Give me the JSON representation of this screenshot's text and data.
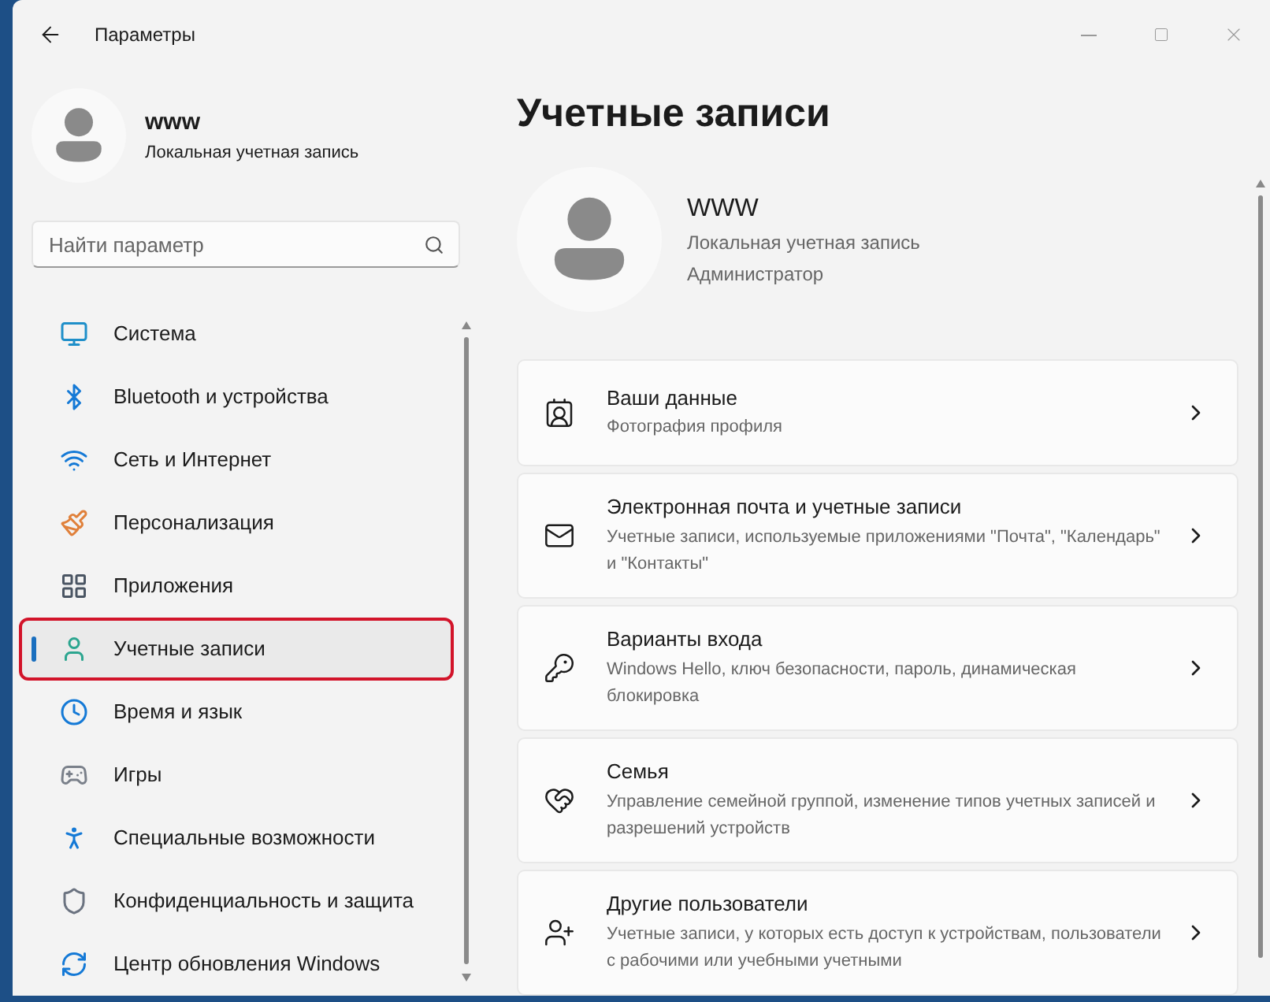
{
  "window": {
    "title": "Параметры"
  },
  "user": {
    "name": "www",
    "account": "Локальная учетная запись"
  },
  "search": {
    "placeholder": "Найти параметр"
  },
  "sidebar": {
    "items": [
      {
        "label": "Система",
        "kind": "system",
        "selected": false,
        "highlighted": false
      },
      {
        "label": "Bluetooth и устройства",
        "kind": "bluetooth",
        "selected": false,
        "highlighted": false
      },
      {
        "label": "Сеть и Интернет",
        "kind": "network",
        "selected": false,
        "highlighted": false
      },
      {
        "label": "Персонализация",
        "kind": "brush",
        "selected": false,
        "highlighted": false
      },
      {
        "label": "Приложения",
        "kind": "apps",
        "selected": false,
        "highlighted": false
      },
      {
        "label": "Учетные записи",
        "kind": "accounts",
        "selected": true,
        "highlighted": true
      },
      {
        "label": "Время и язык",
        "kind": "time",
        "selected": false,
        "highlighted": false
      },
      {
        "label": "Игры",
        "kind": "games",
        "selected": false,
        "highlighted": false
      },
      {
        "label": "Специальные возможности",
        "kind": "accessibility",
        "selected": false,
        "highlighted": false
      },
      {
        "label": "Конфиденциальность и защита",
        "kind": "privacy",
        "selected": false,
        "highlighted": false
      },
      {
        "label": "Центр обновления Windows",
        "kind": "update",
        "selected": false,
        "highlighted": false
      }
    ]
  },
  "page": {
    "title": "Учетные записи",
    "profile": {
      "name": "WWW",
      "account": "Локальная учетная запись",
      "role": "Администратор"
    },
    "cards": [
      {
        "kind": "info",
        "title": "Ваши данные",
        "description": "Фотография профиля"
      },
      {
        "kind": "mail",
        "title": "Электронная почта и учетные записи",
        "description": "Учетные записи, используемые приложениями \"Почта\", \"Календарь\" и \"Контакты\""
      },
      {
        "kind": "key",
        "title": "Варианты входа",
        "description": "Windows Hello, ключ безопасности, пароль, динамическая блокировка"
      },
      {
        "kind": "family",
        "title": "Семья",
        "description": "Управление семейной группой, изменение типов учетных записей и разрешений устройств"
      },
      {
        "kind": "users",
        "title": "Другие пользователи",
        "description": "Учетные записи, у которых есть доступ к устройствам, пользователи с рабочими или учебными учетными"
      }
    ]
  }
}
